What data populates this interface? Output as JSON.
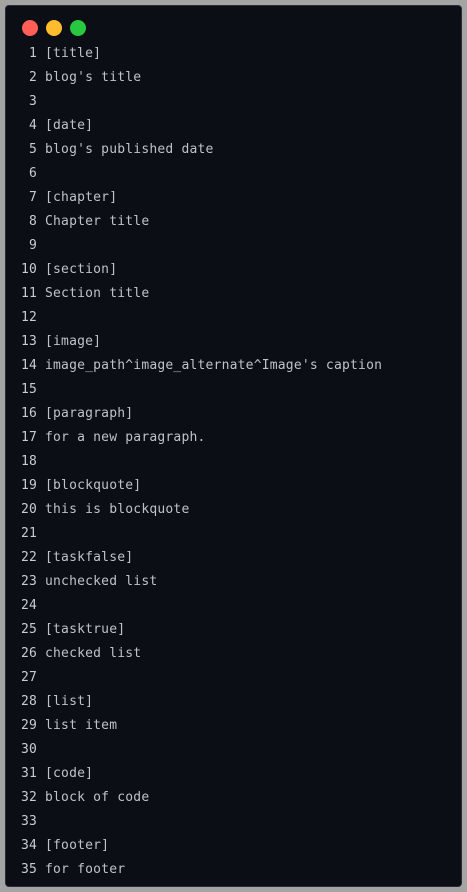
{
  "window": {
    "controls": {
      "close_color": "#ff5f57",
      "minimize_color": "#febc2e",
      "maximize_color": "#28c840"
    }
  },
  "editor": {
    "lines": [
      {
        "number": "1",
        "text": "[title]"
      },
      {
        "number": "2",
        "text": "blog's title"
      },
      {
        "number": "3",
        "text": ""
      },
      {
        "number": "4",
        "text": "[date]"
      },
      {
        "number": "5",
        "text": "blog's published date"
      },
      {
        "number": "6",
        "text": ""
      },
      {
        "number": "7",
        "text": "[chapter]"
      },
      {
        "number": "8",
        "text": "Chapter title"
      },
      {
        "number": "9",
        "text": ""
      },
      {
        "number": "10",
        "text": "[section]"
      },
      {
        "number": "11",
        "text": "Section title"
      },
      {
        "number": "12",
        "text": ""
      },
      {
        "number": "13",
        "text": "[image]"
      },
      {
        "number": "14",
        "text": "image_path^image_alternate^Image's caption"
      },
      {
        "number": "15",
        "text": ""
      },
      {
        "number": "16",
        "text": "[paragraph]"
      },
      {
        "number": "17",
        "text": "for a new paragraph."
      },
      {
        "number": "18",
        "text": ""
      },
      {
        "number": "19",
        "text": "[blockquote]"
      },
      {
        "number": "20",
        "text": "this is blockquote"
      },
      {
        "number": "21",
        "text": ""
      },
      {
        "number": "22",
        "text": "[taskfalse]"
      },
      {
        "number": "23",
        "text": "unchecked list"
      },
      {
        "number": "24",
        "text": ""
      },
      {
        "number": "25",
        "text": "[tasktrue]"
      },
      {
        "number": "26",
        "text": "checked list"
      },
      {
        "number": "27",
        "text": ""
      },
      {
        "number": "28",
        "text": "[list]"
      },
      {
        "number": "29",
        "text": "list item"
      },
      {
        "number": "30",
        "text": ""
      },
      {
        "number": "31",
        "text": "[code]"
      },
      {
        "number": "32",
        "text": "block of code"
      },
      {
        "number": "33",
        "text": ""
      },
      {
        "number": "34",
        "text": "[footer]"
      },
      {
        "number": "35",
        "text": "for footer"
      }
    ]
  }
}
